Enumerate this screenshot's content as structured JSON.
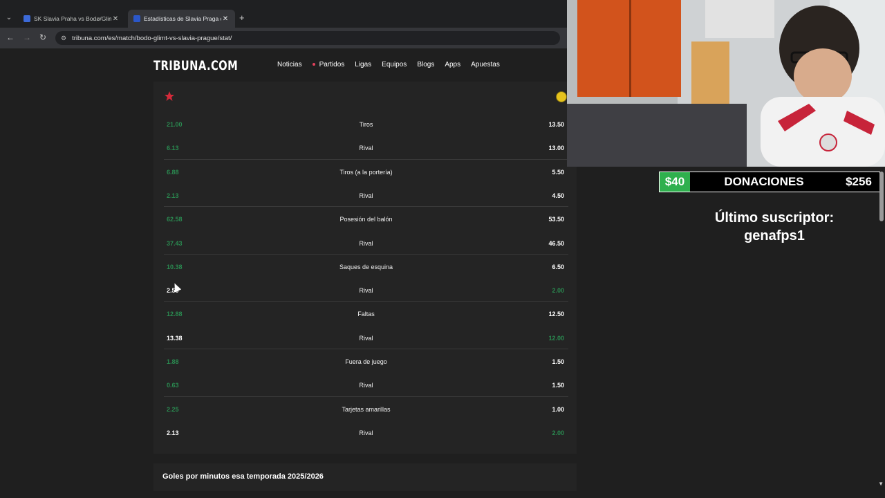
{
  "browser": {
    "tabs": [
      {
        "title": "SK Slavia Praha vs Bodø/Glimt -",
        "active": false,
        "favicon_color": "#3c6ad8"
      },
      {
        "title": "Estadísticas de Slavia Praga con",
        "active": true,
        "favicon_color": "#2b57c9"
      }
    ],
    "url": "tribuna.com/es/match/bodo-glimt-vs-slavia-prague/stat/"
  },
  "site": {
    "logo": "TRIBUNA.COM",
    "nav": [
      "Noticias",
      "Partidos",
      "Ligas",
      "Equipos",
      "Blogs",
      "Apps",
      "Apuestas"
    ]
  },
  "stats": [
    {
      "label": "Tiros",
      "left": "21.00",
      "right": "13.50",
      "left_win": true
    },
    {
      "label": "Rival",
      "left": "6.13",
      "right": "13.00",
      "left_win": true
    },
    {
      "label": "Tiros (a la portería)",
      "left": "6.88",
      "right": "5.50",
      "left_win": true
    },
    {
      "label": "Rival",
      "left": "2.13",
      "right": "4.50",
      "left_win": true
    },
    {
      "label": "Posesión del balón",
      "left": "62.58",
      "right": "53.50",
      "left_win": true
    },
    {
      "label": "Rival",
      "left": "37.43",
      "right": "46.50",
      "left_win": true
    },
    {
      "label": "Saques de esquina",
      "left": "10.38",
      "right": "6.50",
      "left_win": true
    },
    {
      "label": "Rival",
      "left": "2.50",
      "right": "2.00",
      "left_win": false
    },
    {
      "label": "Faltas",
      "left": "12.88",
      "right": "12.50",
      "left_win": true
    },
    {
      "label": "Rival",
      "left": "13.38",
      "right": "12.00",
      "left_win": false
    },
    {
      "label": "Fuera de juego",
      "left": "1.88",
      "right": "1.50",
      "left_win": true
    },
    {
      "label": "Rival",
      "left": "0.63",
      "right": "1.50",
      "left_win": true
    },
    {
      "label": "Tarjetas amarillas",
      "left": "2.25",
      "right": "1.00",
      "left_win": true
    },
    {
      "label": "Rival",
      "left": "2.13",
      "right": "2.00",
      "left_win": false
    }
  ],
  "section_title": "Goles por minutos esa temporada 2025/2026",
  "overlay": {
    "donation_left": "$40",
    "donation_label": "DONACIONES",
    "donation_total": "$256",
    "subscriber_line1": "Último suscriptor:",
    "subscriber_line2": "genafps1"
  },
  "colors": {
    "win_green": "#2a8a50",
    "donation_green": "#2fb04e",
    "live_dot": "#e3405c"
  }
}
